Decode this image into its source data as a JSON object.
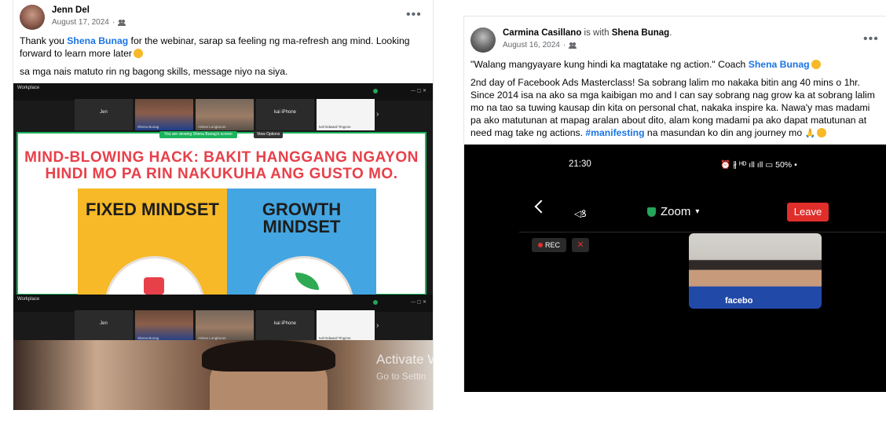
{
  "left_post": {
    "author": "Jenn Del",
    "date": "August 17, 2024",
    "menu": "•••",
    "text1_a": "Thank you ",
    "text1_mention": "Shena Bunag",
    "text1_b": " for the        webinar, sarap sa feeling ng ma-refresh ang mind. Looking forward to learn more later",
    "text2": "sa mga nais matuto rin ng bagong skills, message niyo na siya.",
    "zoom_top": {
      "workplace": "Workplace",
      "tiles": [
        "Jen",
        "Shena Bunag",
        "Arlene Longboom",
        "kai iPhone",
        "Ivel Edward Tingzon"
      ],
      "viewing_banner": "You are viewing  Shena Bunag's screen",
      "view_options": "View Options",
      "slide_title": "MIND-BLOWING HACK: BAKIT HANGGANG NGAYON HINDI MO PA RIN NAKUKUHA ANG GUSTO MO.",
      "panel_left": "FIXED MINDSET",
      "panel_right": "GROWTH MINDSET"
    },
    "zoom_bottom": {
      "workplace": "Workplace",
      "tiles": [
        "Jen",
        "Shena Bunag",
        "Arlene Longboom",
        "kai iPhone",
        "Ivel Edward Tingzon"
      ],
      "activate_1": "Activate W",
      "activate_2": "Go to Settin"
    }
  },
  "right_post": {
    "author": "Carmina Casillano",
    "with_text": " is with ",
    "tagged": "Shena Bunag",
    "tagged_end": ".",
    "date": "August 16, 2024",
    "menu": "•••",
    "line1_a": "\"Walang mangyayare kung hindi ka magtatake ng action.\" Coach ",
    "line1_mention": "Shena Bunag",
    "para_a": "2nd day of Facebook Ads Masterclass! Sa sobrang lalim mo nakaka bitin ang 40 mins o 1hr. Since 2014 isa na ako sa mga kaibigan mo and I can say sobrang nag grow ka at sobrang lalim mo na tao sa tuwing kausap din kita on personal chat, nakaka inspire ka. Nawa'y mas madami pa ako matutunan at mapag aralan about dito, alam kong madami pa ako dapat matutunan at need mag take ng actions. ",
    "para_hashtag": "#manifesting",
    "para_b": " na masundan ko din ang journey mo",
    "phone": {
      "time": "21:30",
      "status": "⏰ ∦ ᴴᴰ ıll ıll ▭ 50% •",
      "zoom_label": "Zoom",
      "leave": "Leave",
      "rec": "REC",
      "self_shirt": "facebo"
    }
  },
  "colors": {
    "mention": "#1b74e4",
    "leave": "#e02e2a",
    "slide_title": "#e8404a",
    "panel_left": "#f7b928",
    "panel_right": "#43a6e2"
  }
}
